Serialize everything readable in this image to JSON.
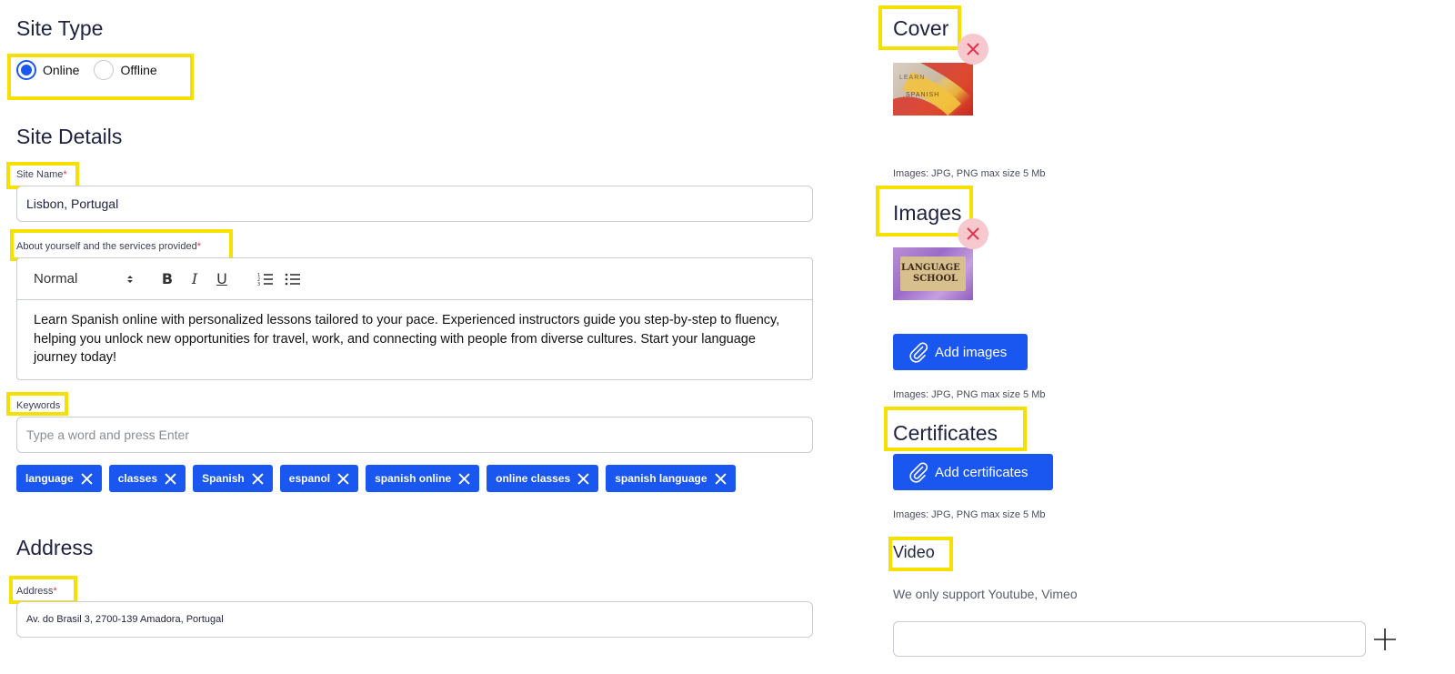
{
  "site_type": {
    "heading": "Site Type",
    "options": [
      {
        "label": "Online",
        "selected": true
      },
      {
        "label": "Offline",
        "selected": false
      }
    ]
  },
  "site_details": {
    "heading": "Site Details",
    "site_name_label": "Site Name",
    "site_name_required": "*",
    "site_name_value": "Lisbon, Portugal",
    "about_label": "About yourself and the services provided",
    "about_required": "*",
    "editor": {
      "format_select": "Normal",
      "bold": "B",
      "italic": "I",
      "underline": "U",
      "body": "Learn Spanish online with personalized lessons tailored to your pace. Experienced instructors guide you step-by-step to fluency, helping you unlock new opportunities for travel, work, and connecting with people from diverse cultures. Start your language journey today!"
    },
    "keywords_label": "Keywords",
    "keywords_placeholder": "Type a word and press Enter",
    "tags": [
      "language",
      "classes",
      "Spanish",
      "espanol",
      "spanish online",
      "online classes",
      "spanish language"
    ]
  },
  "address": {
    "heading": "Address",
    "label": "Address",
    "required": "*",
    "value": "Av. do Brasil 3, 2700-139 Amadora, Portugal"
  },
  "cover": {
    "heading": "Cover",
    "thumb_text_top": "LEARN",
    "thumb_text_bottom": "SPANISH",
    "hint": "Images: JPG, PNG max size 5 Mb"
  },
  "images": {
    "heading": "Images",
    "thumb_text_top": "LANGUAGE",
    "thumb_text_bottom": "SCHOOL",
    "add_button": "Add images",
    "hint": "Images: JPG, PNG max size 5 Mb"
  },
  "certificates": {
    "heading": "Certificates",
    "add_button": "Add certificates",
    "hint": "Images: JPG, PNG max size 5 Mb"
  },
  "video": {
    "heading": "Video",
    "note": "We only support Youtube, Vimeo",
    "value": ""
  },
  "colors": {
    "accent": "#1a56f0",
    "highlight": "#f5e000",
    "remove_badge": "#f7c9cf",
    "remove_x": "#e0344a"
  }
}
